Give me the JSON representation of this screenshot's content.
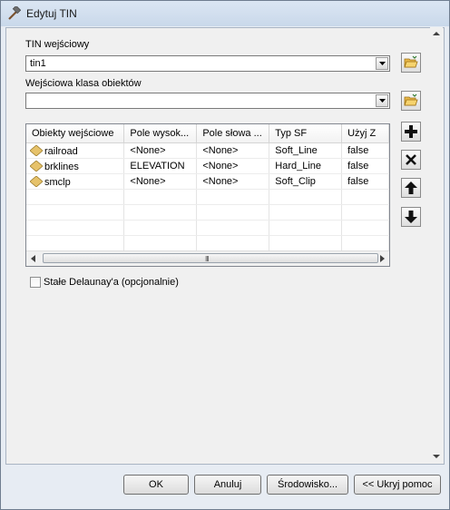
{
  "window": {
    "title": "Edytuj TIN"
  },
  "input_tin": {
    "label": "TIN wejściowy",
    "value": "tin1"
  },
  "input_class": {
    "label": "Wejściowa klasa obiektów",
    "value": ""
  },
  "table": {
    "columns": [
      "Obiekty wejściowe",
      "Pole wysok...",
      "Pole słowa ...",
      "Typ SF",
      "Użyj Z"
    ],
    "rows": [
      [
        "railroad",
        "<None>",
        "<None>",
        "Soft_Line",
        "false"
      ],
      [
        "brklines",
        "ELEVATION",
        "<None>",
        "Hard_Line",
        "false"
      ],
      [
        "smclp",
        "<None>",
        "<None>",
        "Soft_Clip",
        "false"
      ]
    ],
    "scroll_grip": "III"
  },
  "delaunay": {
    "label": "Stałe Delaunay'a (opcjonalnie)",
    "checked": false
  },
  "buttons": {
    "ok": "OK",
    "cancel": "Anuluj",
    "environment": "Środowisko...",
    "hide_help": "<< Ukryj pomoc"
  }
}
